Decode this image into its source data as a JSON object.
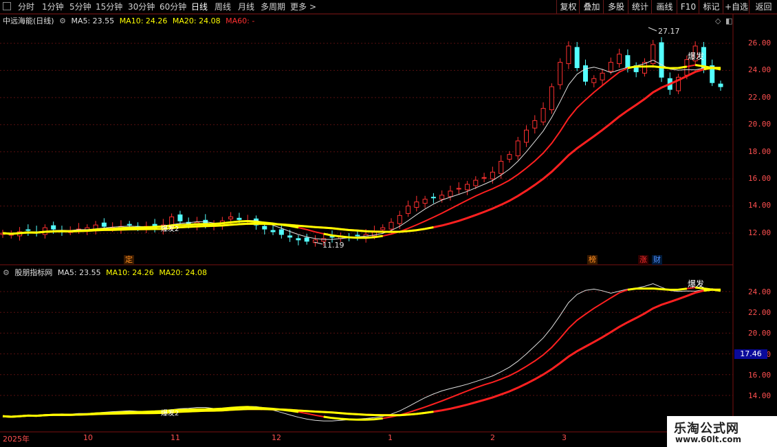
{
  "toolbar": {
    "timeframes": [
      "分时",
      "1分钟",
      "5分钟",
      "15分钟",
      "30分钟",
      "60分钟",
      "日线",
      "周线",
      "月线",
      "多周期",
      "更多"
    ],
    "active_timeframe": "日线",
    "more_arrow": ">",
    "buttons": [
      "复权",
      "叠加",
      "多股",
      "统计",
      "画线",
      "F10",
      "标记",
      "+自选",
      "返回"
    ]
  },
  "main_panel": {
    "stock_name": "中远海能(日线)",
    "ma5_label": "MA5: 23.55",
    "ma10_label": "MA10: 24.26",
    "ma20_label": "MA20: 24.08",
    "ma60_label": "MA60: -",
    "high_annotation": "27.17",
    "low_annotation": "11.19",
    "signal_text": "爆发",
    "signal_text_2": "爆发2",
    "price_axis": [
      "26.00",
      "24.00",
      "22.00",
      "20.00",
      "18.00",
      "16.00",
      "14.00",
      "12.00"
    ],
    "markers": [
      "定",
      "榜",
      "涨",
      "财"
    ]
  },
  "indicator_panel": {
    "title": "股朋指标网",
    "ma5_label": "MA5: 23.55",
    "ma10_label": "MA10: 24.26",
    "ma20_label": "MA20: 24.08",
    "signal_text": "爆发",
    "signal_text_2": "爆发2",
    "price_axis": [
      "24.00",
      "22.00",
      "20.00",
      "18.00",
      "16.00",
      "14.00"
    ],
    "current_price": "17.46"
  },
  "date_axis": [
    "2025年",
    "10",
    "11",
    "12",
    "1",
    "2",
    "3"
  ],
  "watermark": {
    "name": "乐淘公式网",
    "url": "www.60lt.com"
  },
  "colors": {
    "up": "#ff3030",
    "down": "#54ffff",
    "ma_red": "#ff2020",
    "ma_yellow": "#ffff00",
    "ma_white": "#e0e0e0",
    "axis": "#ff5050"
  },
  "chart_data": {
    "type": "candlestick",
    "close_series_approx": [
      12.0,
      11.9,
      12.1,
      12.2,
      12.0,
      12.4,
      12.3,
      12.2,
      12.1,
      12.3,
      12.4,
      12.6,
      12.5,
      12.4,
      12.5,
      12.6,
      12.4,
      12.5,
      12.4,
      12.6,
      13.2,
      12.9,
      12.7,
      12.8,
      12.6,
      12.7,
      12.9,
      13.2,
      13.0,
      12.9,
      12.6,
      12.3,
      12.1,
      11.9,
      11.7,
      11.5,
      11.4,
      11.5,
      11.6,
      11.7,
      11.8,
      11.7,
      11.8,
      11.9,
      12.1,
      12.4,
      12.8,
      13.3,
      14.0,
      14.3,
      14.5,
      14.6,
      14.8,
      15.1,
      15.3,
      15.6,
      15.9,
      16.1,
      16.5,
      17.3,
      17.8,
      18.8,
      19.6,
      20.3,
      21.2,
      22.8,
      24.6,
      25.8,
      24.2,
      23.2,
      23.4,
      23.8,
      24.6,
      25.2,
      24.2,
      23.9,
      24.6,
      25.9,
      23.5,
      22.6,
      23.5,
      24.8,
      25.8,
      24.2,
      23.1,
      22.8
    ],
    "ma5_last": 23.55,
    "ma10_last": 24.26,
    "ma20_last": 24.08,
    "high": 27.17,
    "low": 11.19
  }
}
